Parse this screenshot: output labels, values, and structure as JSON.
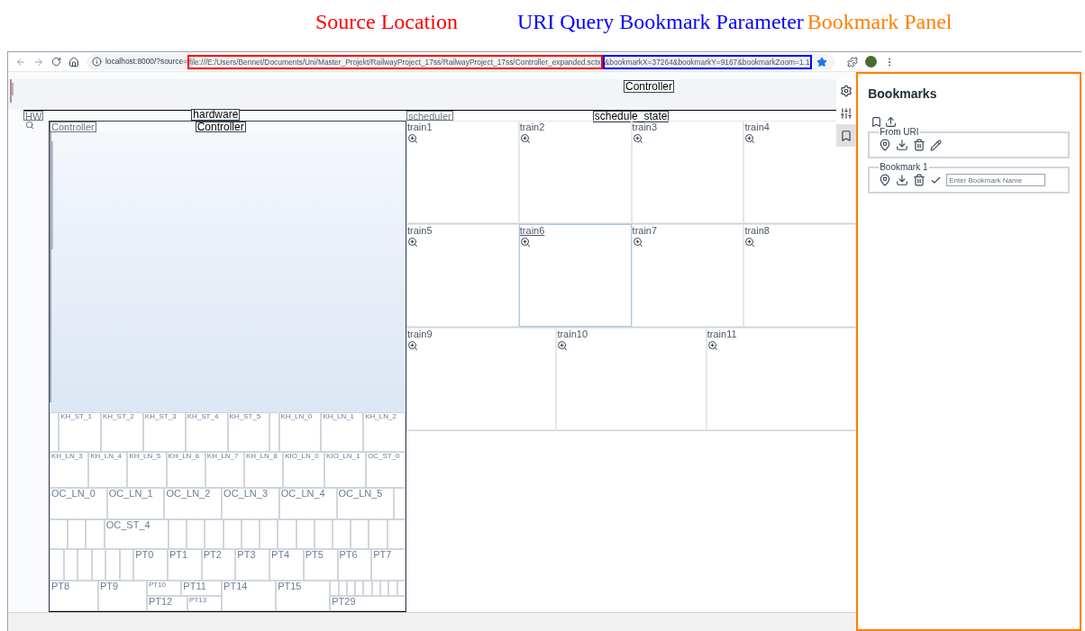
{
  "annotations": [
    {
      "text": "Source Location",
      "color": "#ff0000"
    },
    {
      "text": "URI Query Bookmark Parameter",
      "color": "#0000ff"
    },
    {
      "text": "Bookmark Panel",
      "color": "#ff7f00"
    }
  ],
  "browser": {
    "url": [
      {
        "text": "localhost:8000/?source=",
        "kind": "plain"
      },
      {
        "text": "file:///E:/Users/Bennet/Documents/Uni/Master_Projekt/RailwayProject_17ss/RailwayProject_17ss/Controller_expanded.sctx",
        "kind": "boxed",
        "color": "#ff0000"
      },
      {
        "text": "&bookmarkX=37264&bookmarkY=9167&bookmarkZoom=1.1",
        "kind": "boxed",
        "color": "#0000ff"
      }
    ],
    "bookmarked": true
  },
  "canvas": {
    "title": "Controller",
    "hardware": {
      "tag": "HW",
      "label": "hardware",
      "controller": {
        "tag": "Controller",
        "label": "Controller",
        "strips": [
          {
            "tiles": [
              {
                "kind": "blank"
              },
              {
                "label": "KH_ST_1",
                "kind": "small"
              },
              {
                "label": "KH_ST_2",
                "kind": "small"
              },
              {
                "label": "KH_ST_3",
                "kind": "small"
              },
              {
                "label": "KH_ST_4",
                "kind": "small"
              },
              {
                "label": "KH_ST_5",
                "kind": "small"
              },
              {
                "kind": "blank"
              },
              {
                "label": "KH_LN_0",
                "kind": "small"
              },
              {
                "label": "KH_LN_1",
                "kind": "small"
              },
              {
                "label": "KH_LN_2",
                "kind": "small"
              }
            ]
          },
          {
            "tiles": [
              {
                "label": "KH_LN_3",
                "kind": "small"
              },
              {
                "label": "KH_LN_4",
                "kind": "small"
              },
              {
                "label": "KH_LN_5",
                "kind": "small"
              },
              {
                "label": "KH_LN_6",
                "kind": "small"
              },
              {
                "label": "KH_LN_7",
                "kind": "small"
              },
              {
                "label": "KH_LN_8",
                "kind": "small"
              },
              {
                "label": "KIO_LN_0",
                "kind": "small"
              },
              {
                "label": "KIO_LN_1",
                "kind": "small"
              },
              {
                "label": "OC_ST_0",
                "kind": "small"
              }
            ]
          },
          {
            "tiles": [
              {
                "label": "OC_LN_0",
                "kind": "medium"
              },
              {
                "label": "OC_LN_1",
                "kind": "medium"
              },
              {
                "label": "OC_LN_2",
                "kind": "medium"
              },
              {
                "label": "OC_LN_3",
                "kind": "medium"
              },
              {
                "label": "OC_LN_4",
                "kind": "medium"
              },
              {
                "label": "OC_LN_5",
                "kind": "medium"
              },
              {
                "kind": "blank"
              }
            ]
          },
          {
            "tiles": [
              {
                "kind": "blank"
              },
              {
                "kind": "blank"
              },
              {
                "kind": "blank"
              },
              {
                "label": "OC_ST_4",
                "kind": "medium"
              },
              {
                "kind": "blank"
              },
              {
                "kind": "blank"
              },
              {
                "kind": "blank"
              },
              {
                "kind": "blank"
              },
              {
                "kind": "blank"
              },
              {
                "kind": "blank"
              },
              {
                "kind": "blank"
              },
              {
                "kind": "blank"
              },
              {
                "kind": "blank"
              },
              {
                "kind": "blank"
              },
              {
                "kind": "blank"
              },
              {
                "kind": "blank"
              },
              {
                "kind": "blank"
              }
            ]
          },
          {
            "tiles": [
              {
                "kind": "blank"
              },
              {
                "kind": "blank"
              },
              {
                "kind": "blank"
              },
              {
                "kind": "blank"
              },
              {
                "kind": "blank"
              },
              {
                "kind": "blank"
              },
              {
                "label": "PT0",
                "kind": "medium"
              },
              {
                "label": "PT1",
                "kind": "medium"
              },
              {
                "label": "PT2",
                "kind": "medium"
              },
              {
                "label": "PT3",
                "kind": "medium"
              },
              {
                "label": "PT4",
                "kind": "medium"
              },
              {
                "label": "PT5",
                "kind": "medium"
              },
              {
                "label": "PT6",
                "kind": "medium"
              },
              {
                "label": "PT7",
                "kind": "medium"
              }
            ]
          },
          {
            "tiles": [
              {
                "label": "PT8",
                "kind": "medium"
              },
              {
                "label": "PT9",
                "kind": "medium"
              },
              {
                "kind": "group",
                "strips": [
                  {
                    "tiles": [
                      {
                        "label": "PT10",
                        "kind": "small"
                      },
                      {
                        "label": "PT11",
                        "kind": "medium"
                      }
                    ]
                  },
                  {
                    "tiles": [
                      {
                        "label": "PT12",
                        "kind": "medium"
                      },
                      {
                        "label": "PT13",
                        "kind": "small"
                      }
                    ]
                  }
                ]
              },
              {
                "label": "PT14",
                "kind": "medium"
              },
              {
                "label": "PT15",
                "kind": "medium"
              },
              {
                "kind": "group",
                "strips": [
                  {
                    "tiles": [
                      {
                        "kind": "blank"
                      },
                      {
                        "kind": "blank"
                      },
                      {
                        "kind": "blank"
                      },
                      {
                        "kind": "blank"
                      },
                      {
                        "kind": "blank"
                      },
                      {
                        "kind": "blank"
                      },
                      {
                        "kind": "blank"
                      },
                      {
                        "kind": "blank"
                      },
                      {
                        "kind": "blank"
                      }
                    ]
                  },
                  {
                    "tiles": [
                      {
                        "label": "PT29",
                        "kind": "medium"
                      }
                    ]
                  }
                ]
              }
            ]
          }
        ]
      }
    },
    "scheduler": {
      "tag": "scheduler",
      "label": "schedule_state",
      "rows": [
        [
          {
            "name": "train1",
            "selected": false
          },
          {
            "name": "train2",
            "selected": false
          },
          {
            "name": "train3",
            "selected": false
          },
          {
            "name": "train4",
            "selected": false
          }
        ],
        [
          {
            "name": "train5",
            "selected": false
          },
          {
            "name": "train6",
            "selected": true
          },
          {
            "name": "train7",
            "selected": false
          },
          {
            "name": "train8",
            "selected": false
          }
        ],
        [
          {
            "name": "train9",
            "selected": false
          },
          {
            "name": "train10",
            "selected": false
          },
          {
            "name": "train11",
            "selected": false
          }
        ]
      ]
    }
  },
  "toolbar": [
    {
      "kind": "settings",
      "selected": false
    },
    {
      "kind": "filters",
      "selected": false
    },
    {
      "kind": "bookmarks",
      "selected": true
    }
  ],
  "bookmark_panel": {
    "title": "Bookmarks",
    "groups": [
      {
        "name": "From URI",
        "kind": "uri"
      },
      {
        "name": "Bookmark 1",
        "kind": "new",
        "placeholder": "Enter Bookmark Name"
      }
    ]
  }
}
